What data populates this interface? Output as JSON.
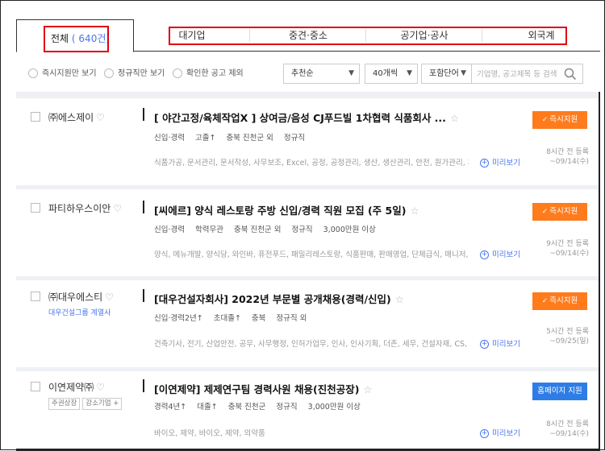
{
  "tabs": {
    "all_label": "전체",
    "all_count": "( 640건)",
    "items": [
      "대기업",
      "중견·중소",
      "공기업·공사",
      "외국계"
    ]
  },
  "filters": {
    "radios": [
      "즉시지원만 보기",
      "정규직만 보기",
      "확인한 공고 제외"
    ],
    "sort": "추천순",
    "per_page": "40개씩",
    "word_mode": "포함단어",
    "search_placeholder": "기업명, 공고제목 등 검색"
  },
  "jobs": [
    {
      "company": "㈜에스제이",
      "title": "[ 야간고정/육체작업X ] 상여금/음성 CJ푸드빌 1차협력 식품회사 ...",
      "meta": [
        "신입·경력",
        "고졸↑",
        "충북 진천군 외",
        "정규직"
      ],
      "tags": "식품가공, 문서관리, 문서작성, 사무보조, Excel, 공정, 공정관리, 생산, 생산관리, 안전, 원가관리, 자...",
      "preview": "미리보기",
      "button": "즉시지원",
      "registered": "8시간 전 등록",
      "deadline": "~09/14(수)"
    },
    {
      "company": "파티하우스이안",
      "title": "[씨에르] 양식 레스토랑 주방 신입/경력 직원 모집 (주 5일)",
      "meta": [
        "신입·경력",
        "학력무관",
        "충북 진천군 외",
        "정규직",
        "3,000만원 이상"
      ],
      "tags": "양식, 메뉴개발, 양식당, 와인바, 퓨전푸드, 패밀리레스토랑, 식품판매, 판매영업, 단체급식, 매니저, ...",
      "preview": "미리보기",
      "button": "즉시지원",
      "registered": "9시간 전 등록",
      "deadline": "~09/14(수)"
    },
    {
      "company": "㈜대우에스티",
      "sub": "대우건설그룹 계열사",
      "title": "[대우건설자회사] 2022년 부문별 공개채용(경력/신입)",
      "meta": [
        "신입·경력2년↑",
        "초대졸↑",
        "충북",
        "정규직 외"
      ],
      "tags": "건축기사, 전기, 산업안전, 공무, 사무행정, 인허가업무, 인사, 인사기획, 더존, 세무, 건설자재, CS, 유...",
      "preview": "미리보기",
      "button": "즉시지원",
      "registered": "5시간 전 등록",
      "deadline": "~09/25(일)"
    },
    {
      "company": "이연제약㈜",
      "badges": [
        "주권상장",
        "강소기업 +"
      ],
      "title": "[이연제약] 제제연구팀 경력사원 채용(진천공장)",
      "meta": [
        "경력4년↑",
        "대졸↑",
        "충북 진천군",
        "정규직",
        "3,000만원 이상"
      ],
      "tags": "바이오, 제약, 바이오, 제약, 의약품",
      "preview": "미리보기",
      "button": "홈페이지 지원",
      "registered": "8시간 전 등록",
      "deadline": "~09/14(수)"
    }
  ],
  "colors": {
    "accent_blue": "#4876ef",
    "apply_orange": "#ff7b1c",
    "homepage_blue": "#2e7de6",
    "highlight_red": "#e0000f"
  }
}
